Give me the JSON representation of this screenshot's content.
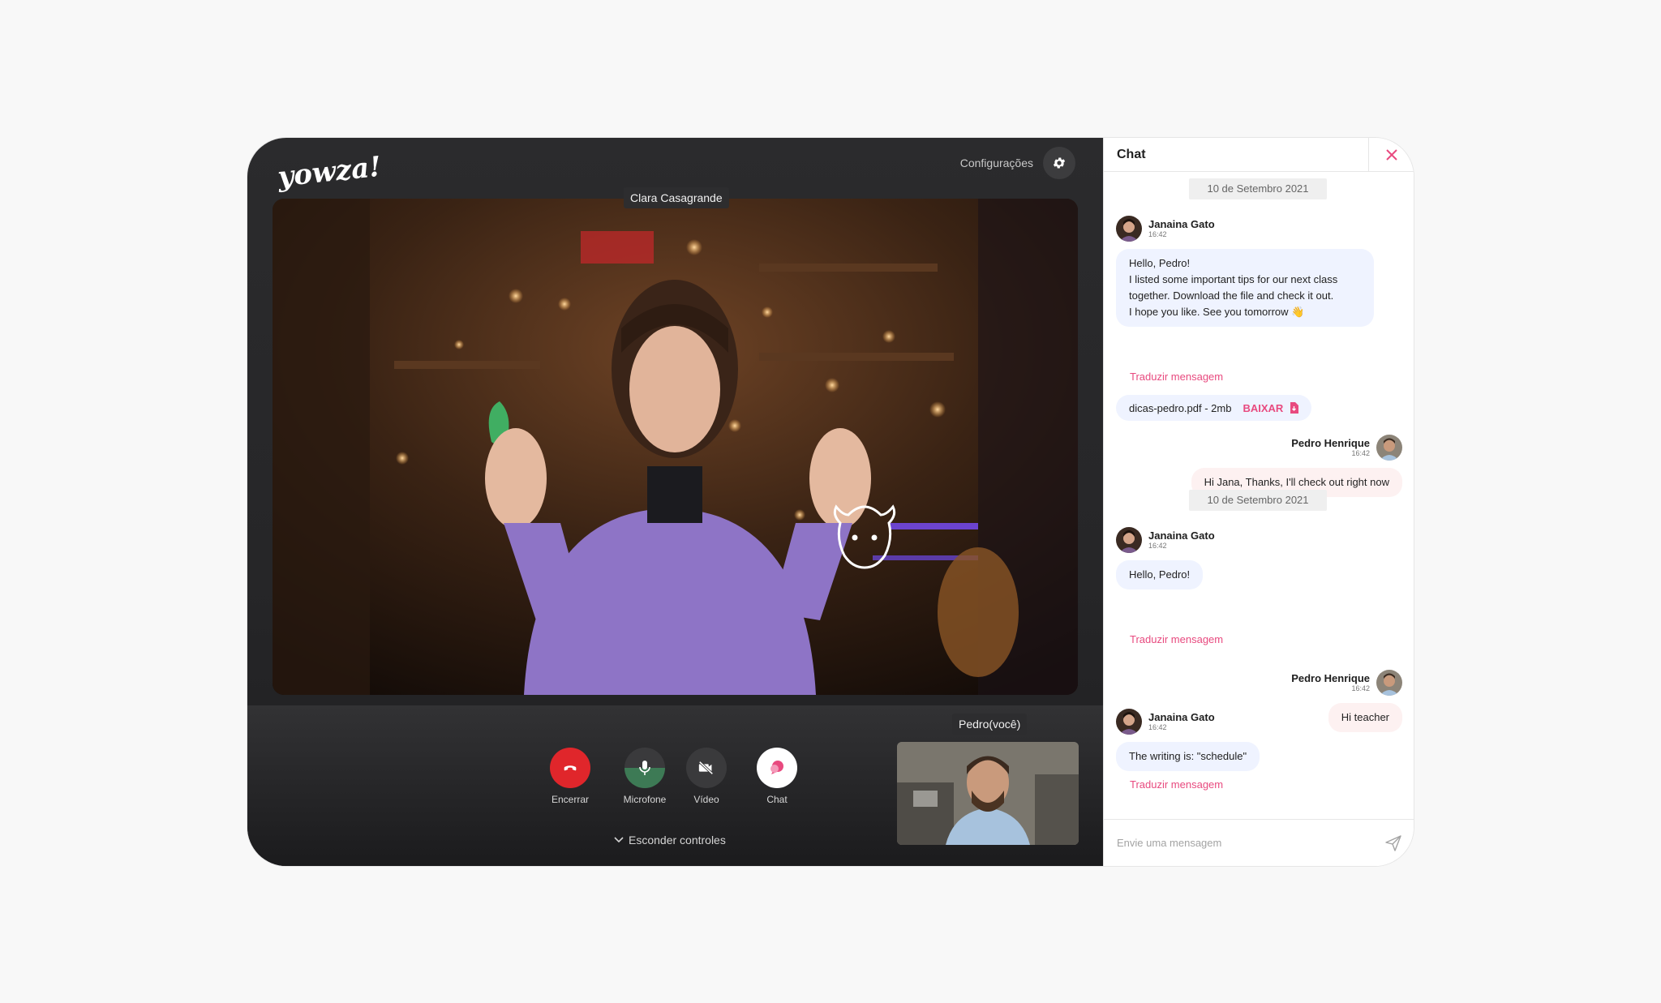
{
  "app": {
    "logo_text": "yowza!"
  },
  "header": {
    "settings_label": "Configurações",
    "settings_icon": "gear-icon"
  },
  "main_video": {
    "participant_name": "Clara Casagrande"
  },
  "self_video": {
    "participant_name": "Pedro(você)"
  },
  "controls": {
    "end": {
      "label": "Encerrar",
      "icon": "phone-hangup-icon",
      "color": "#e0262b"
    },
    "mic": {
      "label": "Microfone",
      "icon": "microphone-icon",
      "level_fraction": 0.5,
      "color": "#3d7a55"
    },
    "video": {
      "label": "Vídeo",
      "icon": "video-off-icon"
    },
    "chat": {
      "label": "Chat",
      "icon": "chat-bubble-icon",
      "color": "#e84a7f"
    },
    "hide_label": "Esconder controles"
  },
  "chat": {
    "title": "Chat",
    "close_icon": "close-icon",
    "date_1": "10 de Setembro 2021",
    "date_2": "10 de Setembro 2021",
    "messages": [
      {
        "sender": "Janaina Gato",
        "time": "16:42",
        "side": "left",
        "lines": [
          "Hello, Pedro!",
          "I listed some important tips for our next class",
          "together. Download the file and check it out.",
          "I hope you like. See you tomorrow 👋"
        ],
        "translate": "Traduzir mensagem"
      },
      {
        "sender": "Pedro Henrique",
        "time": "16:42",
        "side": "right",
        "text": "Hi Jana, Thanks, I'll check out right now"
      },
      {
        "sender": "Janaina Gato",
        "time": "16:42",
        "side": "left",
        "text": "Hello, Pedro!",
        "translate": "Traduzir mensagem"
      },
      {
        "sender": "Pedro Henrique",
        "time": "16:42",
        "side": "right",
        "text": "Hi teacher"
      },
      {
        "sender": "Janaina Gato",
        "time": "16:42",
        "side": "left",
        "text": "The writing is: \"schedule\"",
        "translate": "Traduzir mensagem"
      }
    ],
    "attachment": {
      "filename": "dicas-pedro.pdf - 2mb",
      "download_label": "BAIXAR",
      "icon": "file-download-icon"
    },
    "input": {
      "placeholder": "Envie uma mensagem",
      "value": "",
      "send_icon": "send-icon"
    }
  },
  "colors": {
    "accent": "#e84a7f",
    "bubble_left": "#eff3ff",
    "bubble_right": "#fdf1f1",
    "dark_bg": "#2b2b2d"
  }
}
